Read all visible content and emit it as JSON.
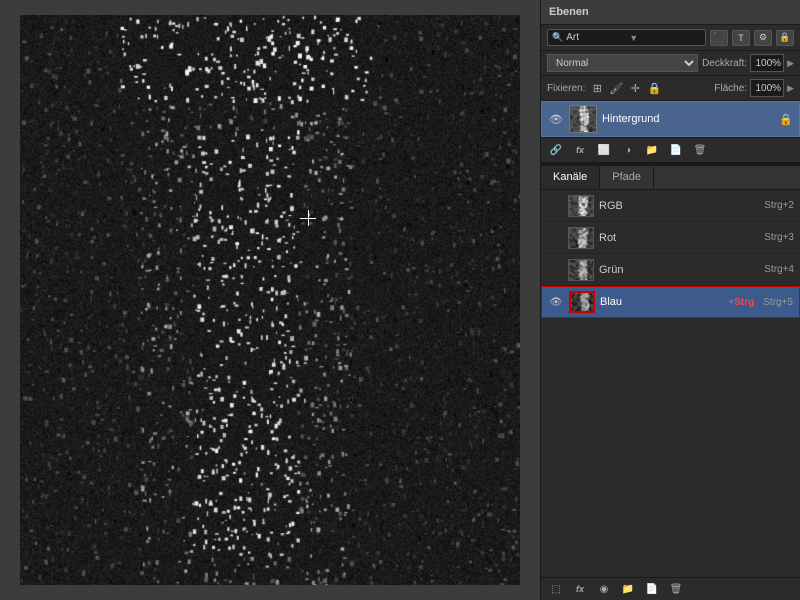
{
  "panel": {
    "title": "Ebenen",
    "search_placeholder": "Art",
    "blend_mode": "Normal",
    "opacity_label": "Deckkraft:",
    "opacity_value": "100%",
    "fix_label": "Fixieren:",
    "flaeche_label": "Fläche:",
    "flaeche_value": "100%",
    "layer": {
      "name": "Hintergrund"
    },
    "bottom_icons": [
      "link-icon",
      "fx-icon",
      "mask-icon",
      "adjustment-icon",
      "folder-icon",
      "new-layer-icon",
      "delete-icon"
    ]
  },
  "channels": {
    "tabs": [
      {
        "label": "Kanäle",
        "active": true
      },
      {
        "label": "Pfade",
        "active": false
      }
    ],
    "items": [
      {
        "name": "RGB",
        "shortcut": "Strg+2",
        "active": false
      },
      {
        "name": "Rot",
        "shortcut": "Strg+3",
        "active": false
      },
      {
        "name": "Grün",
        "shortcut": "Strg+4",
        "active": false
      },
      {
        "name": "Blau",
        "shortcut": "+Strg",
        "shortcut2": "Strg+5",
        "active": true
      }
    ]
  },
  "icons": {
    "eye": "👁",
    "lock": "🔒",
    "link": "🔗",
    "search": "🔍"
  }
}
